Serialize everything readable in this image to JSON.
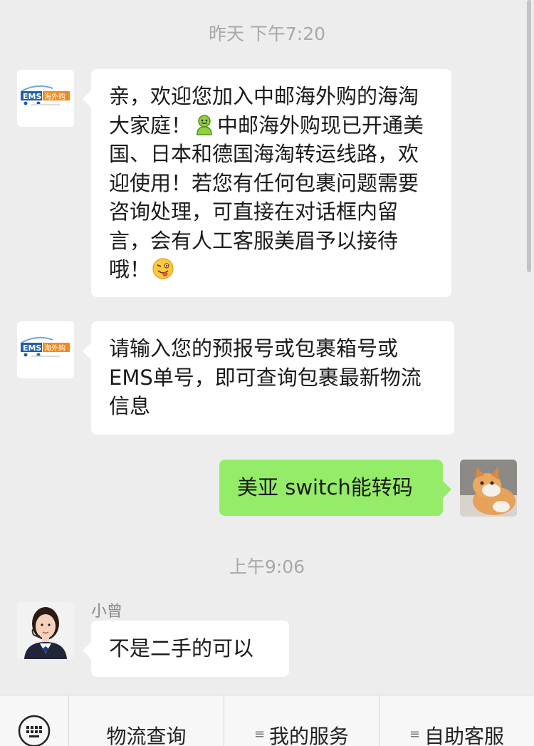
{
  "timestamps": {
    "first": "昨天 下午7:20",
    "second": "上午9:06"
  },
  "messages": [
    {
      "sender": "ems-bot",
      "avatar_logo_text": "EMS",
      "avatar_logo_subtext": "海外购",
      "text_parts": [
        "亲，欢迎您加入中邮海外购的海淘大家庭！",
        "中邮海外购现已开通美国、日本和德国海淘转运线路，欢迎使用！若您有任何包裹问题需要咨询处理，可直接在对话框内留言，会有人工客服美眉予以接待哦！"
      ]
    },
    {
      "sender": "ems-bot",
      "text": "请输入您的预报号或包裹箱号或EMS单号，即可查询包裹最新物流信息"
    },
    {
      "sender": "me",
      "text": "美亚 switch能转码"
    },
    {
      "sender": "agent",
      "name": "小曾",
      "text": "不是二手的可以"
    }
  ],
  "menu": {
    "keyboard_icon": "keyboard-icon",
    "items": [
      {
        "label": "物流查询",
        "has_submenu": false
      },
      {
        "label": "我的服务",
        "has_submenu": true
      },
      {
        "label": "自助客服",
        "has_submenu": true
      }
    ],
    "submenu_icon": "≡"
  },
  "colors": {
    "background": "#ededed",
    "my_bubble": "#95ec69",
    "other_bubble": "#ffffff",
    "ems_blue": "#1f5fa8",
    "ems_orange": "#f08a1c"
  }
}
